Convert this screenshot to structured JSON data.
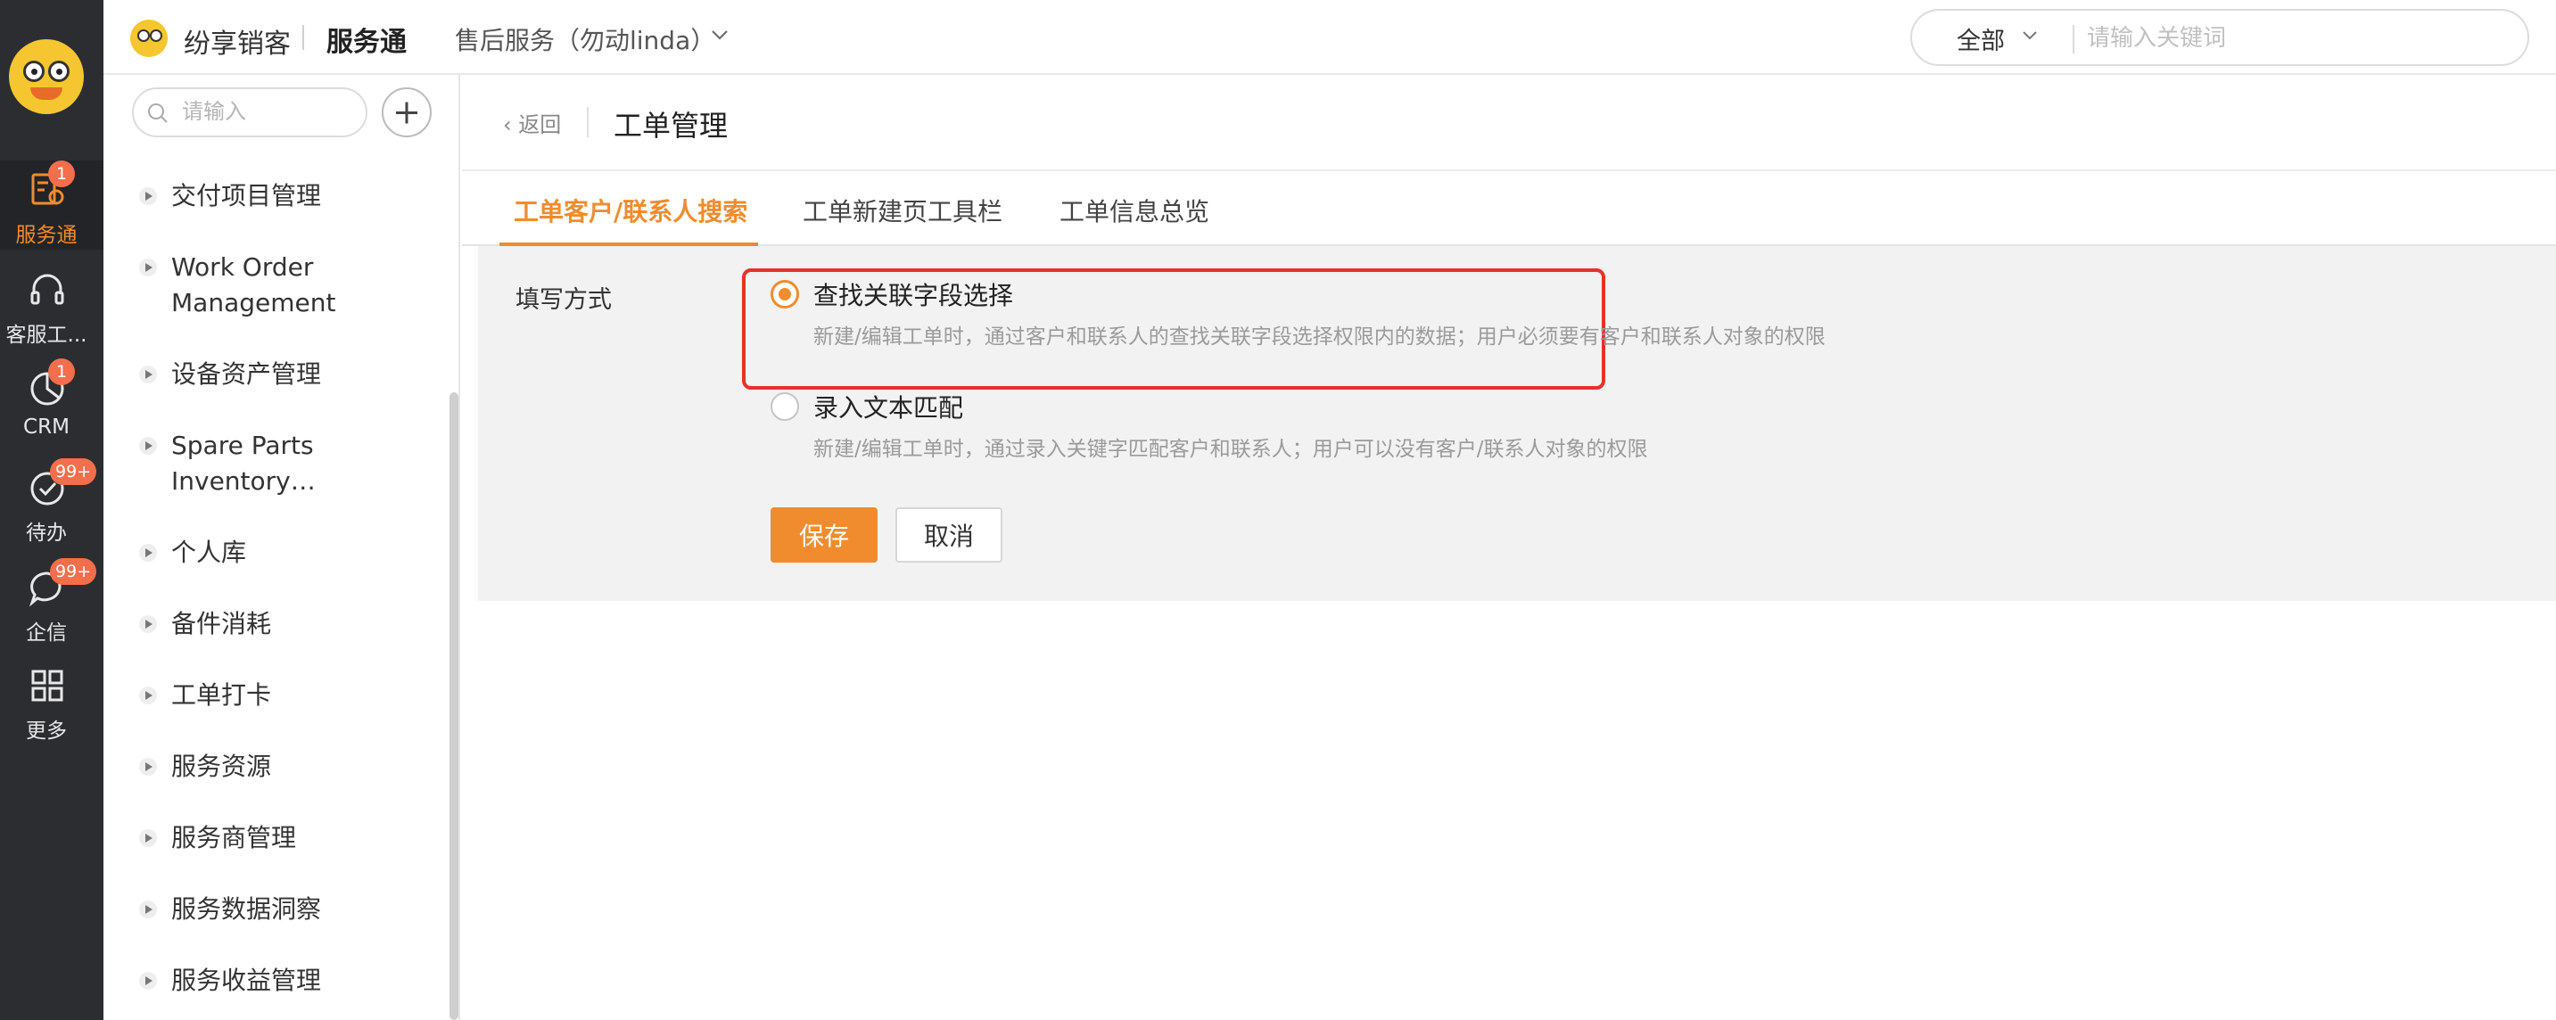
{
  "colors": {
    "accent": "#f08c2d",
    "rail_bg": "#2b2d31",
    "badge": "#f36e4b",
    "highlight": "#e5322d",
    "panel_bg": "#f2f2f2"
  },
  "rail": {
    "items": [
      {
        "label": "服务通",
        "icon": "service-clipboard-icon",
        "badge": "1",
        "active": true
      },
      {
        "label": "客服工...",
        "icon": "headset-icon",
        "badge": "",
        "active": false
      },
      {
        "label": "CRM",
        "icon": "pie-chart-icon",
        "badge": "1",
        "active": false
      },
      {
        "label": "待办",
        "icon": "check-circle-icon",
        "badge": "99+",
        "active": false
      },
      {
        "label": "企信",
        "icon": "chat-bubble-icon",
        "badge": "99+",
        "active": false
      },
      {
        "label": "更多",
        "icon": "grid-icon",
        "badge": "",
        "active": false
      }
    ]
  },
  "topbar": {
    "brand_name": "纷享销客",
    "app_name": "服务通",
    "tenant": "售后服务（勿动linda）",
    "scope": "全部",
    "search_placeholder": "请输入关键词"
  },
  "sidebar": {
    "search_placeholder": "请输入",
    "items": [
      {
        "label": "交付项目管理"
      },
      {
        "label": "Work Order Management"
      },
      {
        "label": "设备资产管理"
      },
      {
        "label": "Spare Parts Inventory…"
      },
      {
        "label": "个人库"
      },
      {
        "label": "备件消耗"
      },
      {
        "label": "工单打卡"
      },
      {
        "label": "服务资源"
      },
      {
        "label": "服务商管理"
      },
      {
        "label": "服务数据洞察"
      },
      {
        "label": "服务收益管理"
      }
    ]
  },
  "main": {
    "back_label": "返回",
    "title": "工单管理",
    "tabs": [
      {
        "label": "工单客户/联系人搜索",
        "active": true
      },
      {
        "label": "工单新建页工具栏",
        "active": false
      },
      {
        "label": "工单信息总览",
        "active": false
      }
    ],
    "form": {
      "field_label": "填写方式",
      "options": [
        {
          "title": "查找关联字段选择",
          "desc": "新建/编辑工单时，通过客户和联系人的查找关联字段选择权限内的数据；用户必须要有客户和联系人对象的权限",
          "checked": true
        },
        {
          "title": "录入文本匹配",
          "desc": "新建/编辑工单时，通过录入关键字匹配客户和联系人；用户可以没有客户/联系人对象的权限",
          "checked": false
        }
      ],
      "save_label": "保存",
      "cancel_label": "取消"
    }
  }
}
